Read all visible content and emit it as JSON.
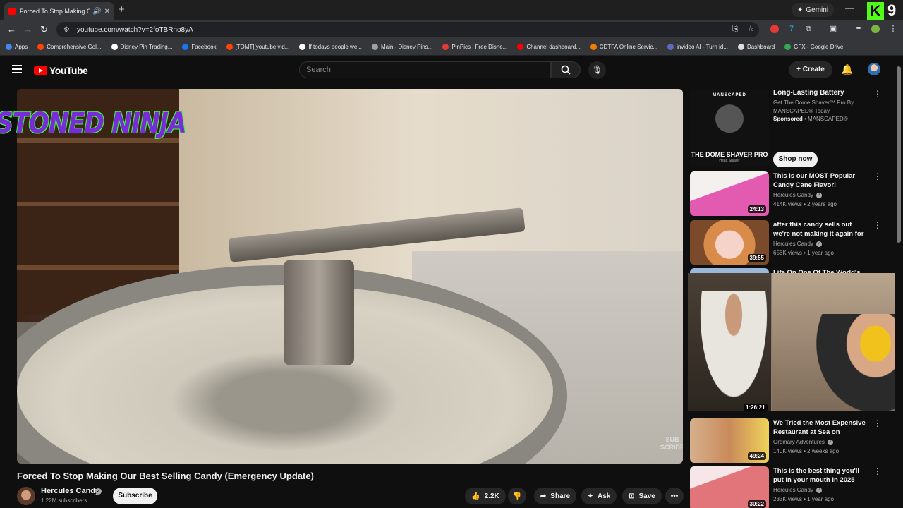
{
  "browser": {
    "tab_title": "Forced To Stop Making Our",
    "url": "youtube.com/watch?v=2foTBRno8yA",
    "gemini_label": "Gemini",
    "profile_badge_letter": "K",
    "profile_badge_number": "9",
    "bookmarks": [
      {
        "label": "Apps",
        "color": "#4285f4"
      },
      {
        "label": "Comprehensive Gol...",
        "color": "#ff4500"
      },
      {
        "label": "Disney Pin Trading...",
        "color": "#ffffff"
      },
      {
        "label": "Facebook",
        "color": "#1877f2"
      },
      {
        "label": "[TOMT][youtube vid...",
        "color": "#ff4500"
      },
      {
        "label": "If todays people we...",
        "color": "#ffffff"
      },
      {
        "label": "Main - Disney Pins...",
        "color": "#9aa0a6"
      },
      {
        "label": "PinPics | Free Disne...",
        "color": "#e53935"
      },
      {
        "label": "Channel dashboard...",
        "color": "#ff0000"
      },
      {
        "label": "CDTFA Online Servic...",
        "color": "#f57c00"
      },
      {
        "label": "invideo AI - Turn id...",
        "color": "#5c6bc0"
      },
      {
        "label": "Dashboard",
        "color": "#dddddd"
      },
      {
        "label": "GFX - Google Drive",
        "color": "#34a853"
      }
    ]
  },
  "youtube": {
    "logo_text": "YouTube",
    "search_placeholder": "Search",
    "create_label": "Create"
  },
  "video": {
    "title": "Forced To Stop Making Our Best Selling Candy (Emergency Update)",
    "watermark_line1": "SUB",
    "watermark_line2": "SCRIBE",
    "channel": "Hercules Candy",
    "subscribers": "1.22M subscribers",
    "subscribe_label": "Subscribe",
    "likes": "2.2K",
    "share_label": "Share",
    "ask_label": "Ask",
    "save_label": "Save"
  },
  "ad": {
    "brand": "MANSCAPED",
    "product": "THE DOME SHAVER PRO",
    "product_sub": "Head Shaver",
    "title": "Long-Lasting Battery",
    "description": "Get The Dome Shaver™ Pro By MANSCAPED® Today",
    "sponsored": "Sponsored",
    "advertiser": "MANSCAPED®",
    "cta": "Shop now"
  },
  "recommendations": [
    {
      "title": "This is our MOST Popular Candy Cane Flavor!",
      "channel": "Hercules Candy",
      "meta": "414K views • 2 years ago",
      "duration": "24:13",
      "thumb_color": "#e35bb0"
    },
    {
      "title": "after this candy sells out we're not making it again for anothe...",
      "channel": "Hercules Candy",
      "meta": "658K views • 1 year ago",
      "duration": "39:55",
      "thumb_color": "#d98b4a"
    },
    {
      "title": "Life On One Of The World's",
      "duration": "1:26:21"
    },
    {
      "title": "We Tried the Most Expensive Restaurant at Sea on Disney's ...",
      "channel": "Ordinary Adventures",
      "meta": "140K views • 2 weeks ago",
      "duration": "49:24",
      "thumb_color": "#c98a5a"
    },
    {
      "title": "This is the best thing you'll put in your mouth in 2025",
      "channel": "Hercules Candy",
      "meta": "233K views • 1 year ago",
      "duration": "30:22",
      "thumb_color": "#e2757a"
    }
  ],
  "overlay": {
    "text": "STONED NINJA"
  }
}
